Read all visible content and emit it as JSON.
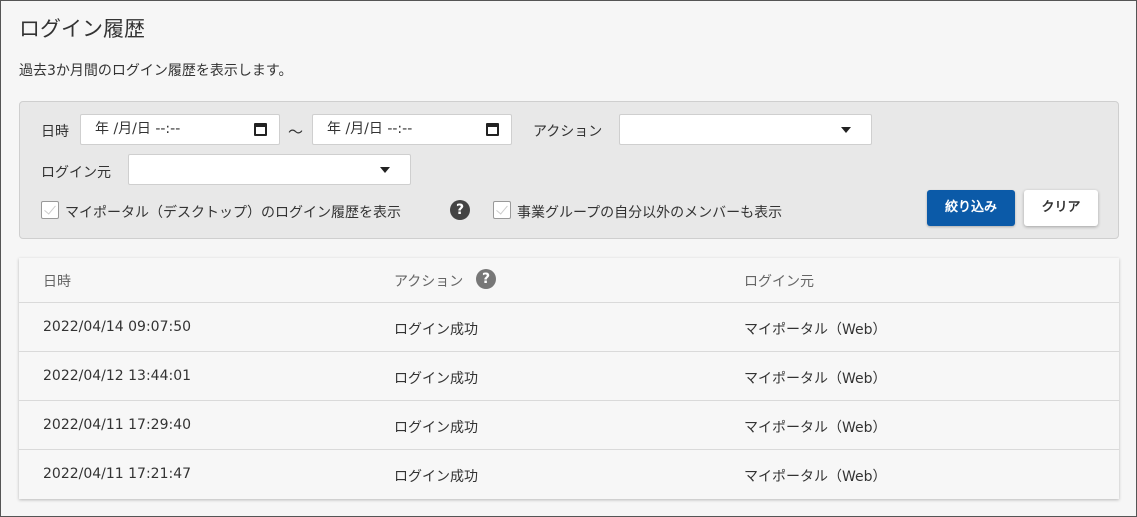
{
  "page": {
    "title": "ログイン履歴",
    "description": "過去3か月間のログイン履歴を表示します。"
  },
  "filter": {
    "datetime_label": "日時",
    "date_from": "年 /月/日 --:--",
    "date_separator": "～",
    "date_to": "年 /月/日 --:--",
    "action_label": "アクション",
    "action_value": "",
    "origin_label": "ログイン元",
    "origin_value": "",
    "checkbox_portal_label": "マイポータル（デスクトップ）のログイン履歴を表示",
    "checkbox_portal_checked": false,
    "checkbox_group_label": "事業グループの自分以外のメンバーも表示",
    "checkbox_group_checked": false,
    "help_icon": "?",
    "filter_button": "絞り込み",
    "clear_button": "クリア"
  },
  "table": {
    "columns": [
      "日時",
      "アクション",
      "ログイン元"
    ],
    "action_help_icon": "?",
    "rows": [
      {
        "datetime": "2022/04/14 09:07:50",
        "action": "ログイン成功",
        "origin": "マイポータル（Web）"
      },
      {
        "datetime": "2022/04/12 13:44:01",
        "action": "ログイン成功",
        "origin": "マイポータル（Web）"
      },
      {
        "datetime": "2022/04/11 17:29:40",
        "action": "ログイン成功",
        "origin": "マイポータル（Web）"
      },
      {
        "datetime": "2022/04/11 17:21:47",
        "action": "ログイン成功",
        "origin": "マイポータル（Web）"
      }
    ]
  },
  "icons": {
    "calendar": "calendar-icon",
    "dropdown": "chevron-down-icon",
    "help": "help-icon",
    "checkbox": "checkbox-icon"
  },
  "colors": {
    "primary_button": "#0b5aa8",
    "panel_bg": "#e8e8e8",
    "page_bg": "#f6f6f6"
  }
}
